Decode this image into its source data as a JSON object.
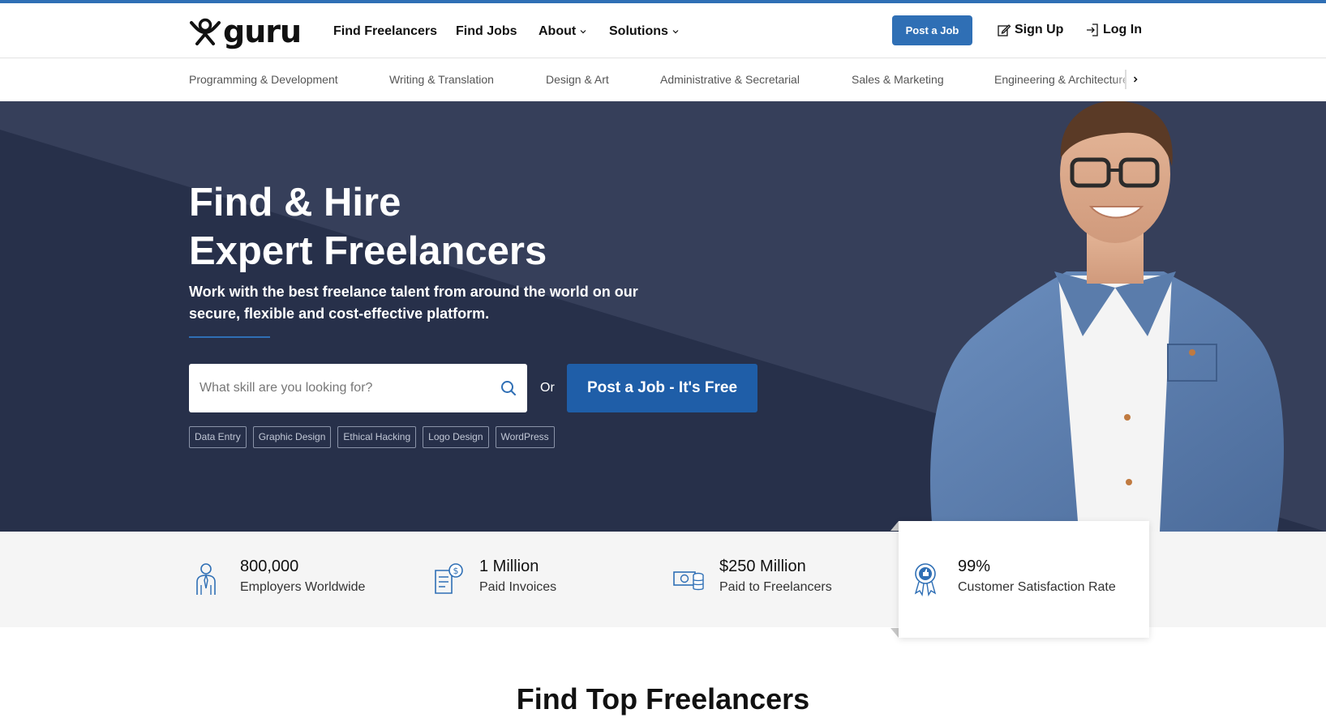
{
  "header": {
    "logo_text": "guru",
    "nav": {
      "find_freelancers": "Find Freelancers",
      "find_jobs": "Find Jobs",
      "about": "About",
      "solutions": "Solutions"
    },
    "post_job": "Post a Job",
    "sign_up": "Sign Up",
    "log_in": "Log In"
  },
  "categories": [
    "Programming & Development",
    "Writing & Translation",
    "Design & Art",
    "Administrative & Secretarial",
    "Sales & Marketing",
    "Engineering & Architecture"
  ],
  "hero": {
    "title_line1": "Find & Hire",
    "title_line2": "Expert Freelancers",
    "subtitle": "Work with the best freelance talent from around the world on our secure, flexible and cost-effective platform.",
    "search_placeholder": "What skill are you looking for?",
    "or": "Or",
    "post_job": "Post a Job - It's Free",
    "tags": [
      "Data Entry",
      "Graphic Design",
      "Ethical Hacking",
      "Logo Design",
      "WordPress"
    ]
  },
  "stats": [
    {
      "value": "800,000",
      "label": "Employers Worldwide",
      "icon": "employer-icon"
    },
    {
      "value": "1 Million",
      "label": "Paid Invoices",
      "icon": "invoice-icon"
    },
    {
      "value": "$250 Million",
      "label": "Paid to Freelancers",
      "icon": "money-icon"
    },
    {
      "value": "99%",
      "label": "Customer Satisfaction Rate",
      "icon": "award-icon"
    }
  ],
  "section_title": "Find Top Freelancers",
  "colors": {
    "brand_blue": "#2f6fb5",
    "hero_bg": "#2c3550",
    "stats_bg": "#f5f5f5"
  }
}
